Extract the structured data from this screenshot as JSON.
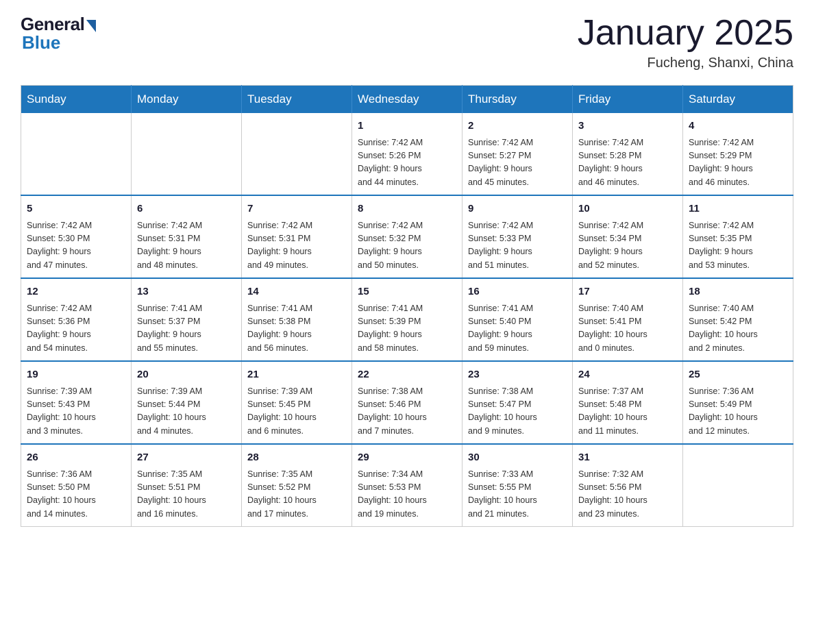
{
  "header": {
    "logo_general": "General",
    "logo_blue": "Blue",
    "title": "January 2025",
    "location": "Fucheng, Shanxi, China"
  },
  "days_of_week": [
    "Sunday",
    "Monday",
    "Tuesday",
    "Wednesday",
    "Thursday",
    "Friday",
    "Saturday"
  ],
  "weeks": [
    [
      {
        "day": "",
        "info": ""
      },
      {
        "day": "",
        "info": ""
      },
      {
        "day": "",
        "info": ""
      },
      {
        "day": "1",
        "info": "Sunrise: 7:42 AM\nSunset: 5:26 PM\nDaylight: 9 hours\nand 44 minutes."
      },
      {
        "day": "2",
        "info": "Sunrise: 7:42 AM\nSunset: 5:27 PM\nDaylight: 9 hours\nand 45 minutes."
      },
      {
        "day": "3",
        "info": "Sunrise: 7:42 AM\nSunset: 5:28 PM\nDaylight: 9 hours\nand 46 minutes."
      },
      {
        "day": "4",
        "info": "Sunrise: 7:42 AM\nSunset: 5:29 PM\nDaylight: 9 hours\nand 46 minutes."
      }
    ],
    [
      {
        "day": "5",
        "info": "Sunrise: 7:42 AM\nSunset: 5:30 PM\nDaylight: 9 hours\nand 47 minutes."
      },
      {
        "day": "6",
        "info": "Sunrise: 7:42 AM\nSunset: 5:31 PM\nDaylight: 9 hours\nand 48 minutes."
      },
      {
        "day": "7",
        "info": "Sunrise: 7:42 AM\nSunset: 5:31 PM\nDaylight: 9 hours\nand 49 minutes."
      },
      {
        "day": "8",
        "info": "Sunrise: 7:42 AM\nSunset: 5:32 PM\nDaylight: 9 hours\nand 50 minutes."
      },
      {
        "day": "9",
        "info": "Sunrise: 7:42 AM\nSunset: 5:33 PM\nDaylight: 9 hours\nand 51 minutes."
      },
      {
        "day": "10",
        "info": "Sunrise: 7:42 AM\nSunset: 5:34 PM\nDaylight: 9 hours\nand 52 minutes."
      },
      {
        "day": "11",
        "info": "Sunrise: 7:42 AM\nSunset: 5:35 PM\nDaylight: 9 hours\nand 53 minutes."
      }
    ],
    [
      {
        "day": "12",
        "info": "Sunrise: 7:42 AM\nSunset: 5:36 PM\nDaylight: 9 hours\nand 54 minutes."
      },
      {
        "day": "13",
        "info": "Sunrise: 7:41 AM\nSunset: 5:37 PM\nDaylight: 9 hours\nand 55 minutes."
      },
      {
        "day": "14",
        "info": "Sunrise: 7:41 AM\nSunset: 5:38 PM\nDaylight: 9 hours\nand 56 minutes."
      },
      {
        "day": "15",
        "info": "Sunrise: 7:41 AM\nSunset: 5:39 PM\nDaylight: 9 hours\nand 58 minutes."
      },
      {
        "day": "16",
        "info": "Sunrise: 7:41 AM\nSunset: 5:40 PM\nDaylight: 9 hours\nand 59 minutes."
      },
      {
        "day": "17",
        "info": "Sunrise: 7:40 AM\nSunset: 5:41 PM\nDaylight: 10 hours\nand 0 minutes."
      },
      {
        "day": "18",
        "info": "Sunrise: 7:40 AM\nSunset: 5:42 PM\nDaylight: 10 hours\nand 2 minutes."
      }
    ],
    [
      {
        "day": "19",
        "info": "Sunrise: 7:39 AM\nSunset: 5:43 PM\nDaylight: 10 hours\nand 3 minutes."
      },
      {
        "day": "20",
        "info": "Sunrise: 7:39 AM\nSunset: 5:44 PM\nDaylight: 10 hours\nand 4 minutes."
      },
      {
        "day": "21",
        "info": "Sunrise: 7:39 AM\nSunset: 5:45 PM\nDaylight: 10 hours\nand 6 minutes."
      },
      {
        "day": "22",
        "info": "Sunrise: 7:38 AM\nSunset: 5:46 PM\nDaylight: 10 hours\nand 7 minutes."
      },
      {
        "day": "23",
        "info": "Sunrise: 7:38 AM\nSunset: 5:47 PM\nDaylight: 10 hours\nand 9 minutes."
      },
      {
        "day": "24",
        "info": "Sunrise: 7:37 AM\nSunset: 5:48 PM\nDaylight: 10 hours\nand 11 minutes."
      },
      {
        "day": "25",
        "info": "Sunrise: 7:36 AM\nSunset: 5:49 PM\nDaylight: 10 hours\nand 12 minutes."
      }
    ],
    [
      {
        "day": "26",
        "info": "Sunrise: 7:36 AM\nSunset: 5:50 PM\nDaylight: 10 hours\nand 14 minutes."
      },
      {
        "day": "27",
        "info": "Sunrise: 7:35 AM\nSunset: 5:51 PM\nDaylight: 10 hours\nand 16 minutes."
      },
      {
        "day": "28",
        "info": "Sunrise: 7:35 AM\nSunset: 5:52 PM\nDaylight: 10 hours\nand 17 minutes."
      },
      {
        "day": "29",
        "info": "Sunrise: 7:34 AM\nSunset: 5:53 PM\nDaylight: 10 hours\nand 19 minutes."
      },
      {
        "day": "30",
        "info": "Sunrise: 7:33 AM\nSunset: 5:55 PM\nDaylight: 10 hours\nand 21 minutes."
      },
      {
        "day": "31",
        "info": "Sunrise: 7:32 AM\nSunset: 5:56 PM\nDaylight: 10 hours\nand 23 minutes."
      },
      {
        "day": "",
        "info": ""
      }
    ]
  ]
}
